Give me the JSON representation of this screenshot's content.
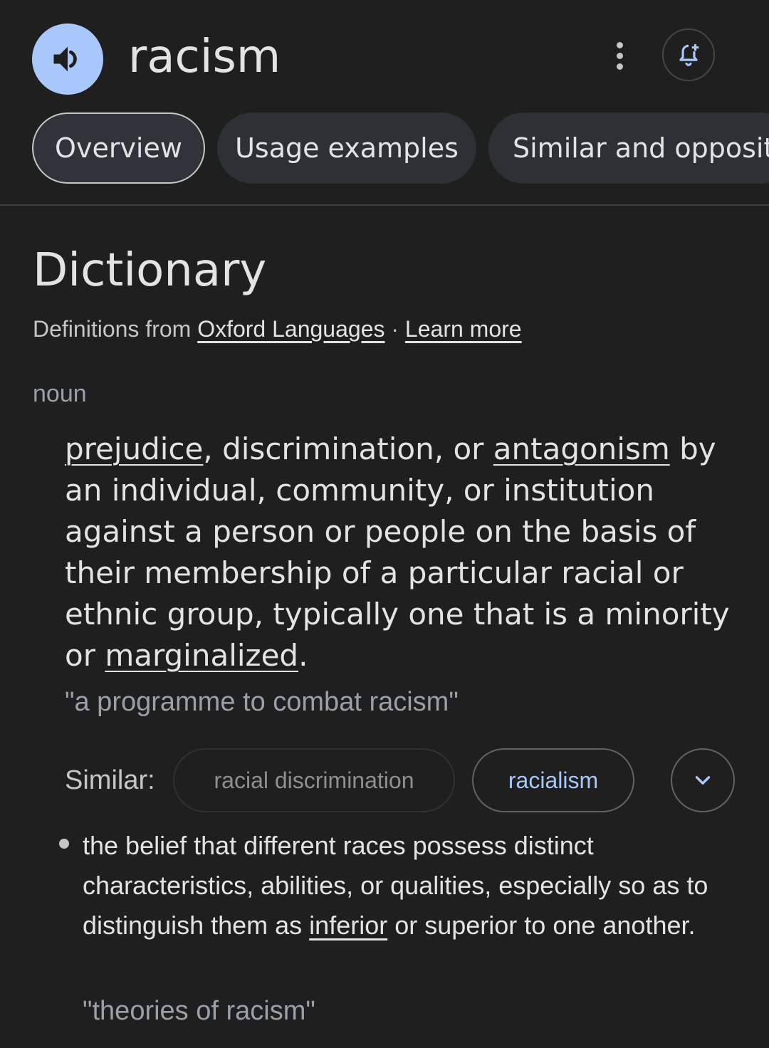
{
  "header": {
    "word": "racism",
    "speaker_icon": "volume-up-icon",
    "more_icon": "more-vert-icon",
    "alert_icon": "add-alert-icon"
  },
  "tabs": [
    {
      "label": "Overview",
      "active": true
    },
    {
      "label": "Usage examples",
      "active": false
    },
    {
      "label": "Similar and opposite",
      "active": false
    }
  ],
  "dictionary": {
    "title": "Dictionary",
    "source_prefix": "Definitions from",
    "source_link": "Oxford Languages",
    "separator": "·",
    "learn_more": "Learn more",
    "part_of_speech": "noun"
  },
  "definition1": {
    "link1": "prejudice",
    "text1": ", discrimination, or ",
    "link2": "antagonism",
    "text2": " by an individual, community, or institution against a person or people on the basis of their membership of a particular racial or ethnic group, typically one that is a minority or ",
    "link3": "marginalized",
    "text3": ".",
    "example": "\"a programme to combat racism\""
  },
  "similar": {
    "label": "Similar:",
    "chips": [
      {
        "label": "racial discrimination",
        "enabled": false
      },
      {
        "label": "racialism",
        "enabled": true
      }
    ],
    "expand_icon": "chevron-down-icon"
  },
  "definition2": {
    "text1": "the belief that different races possess distinct characteristics, abilities, or qualities, especially so as to distinguish them as ",
    "link1": "inferior",
    "text2": " or superior to one another.",
    "example": "\"theories of racism\""
  },
  "colors": {
    "background": "#1f1f1f",
    "accent": "#a8c7fa",
    "text": "#e3e3e3",
    "muted": "#9aa0a6"
  }
}
